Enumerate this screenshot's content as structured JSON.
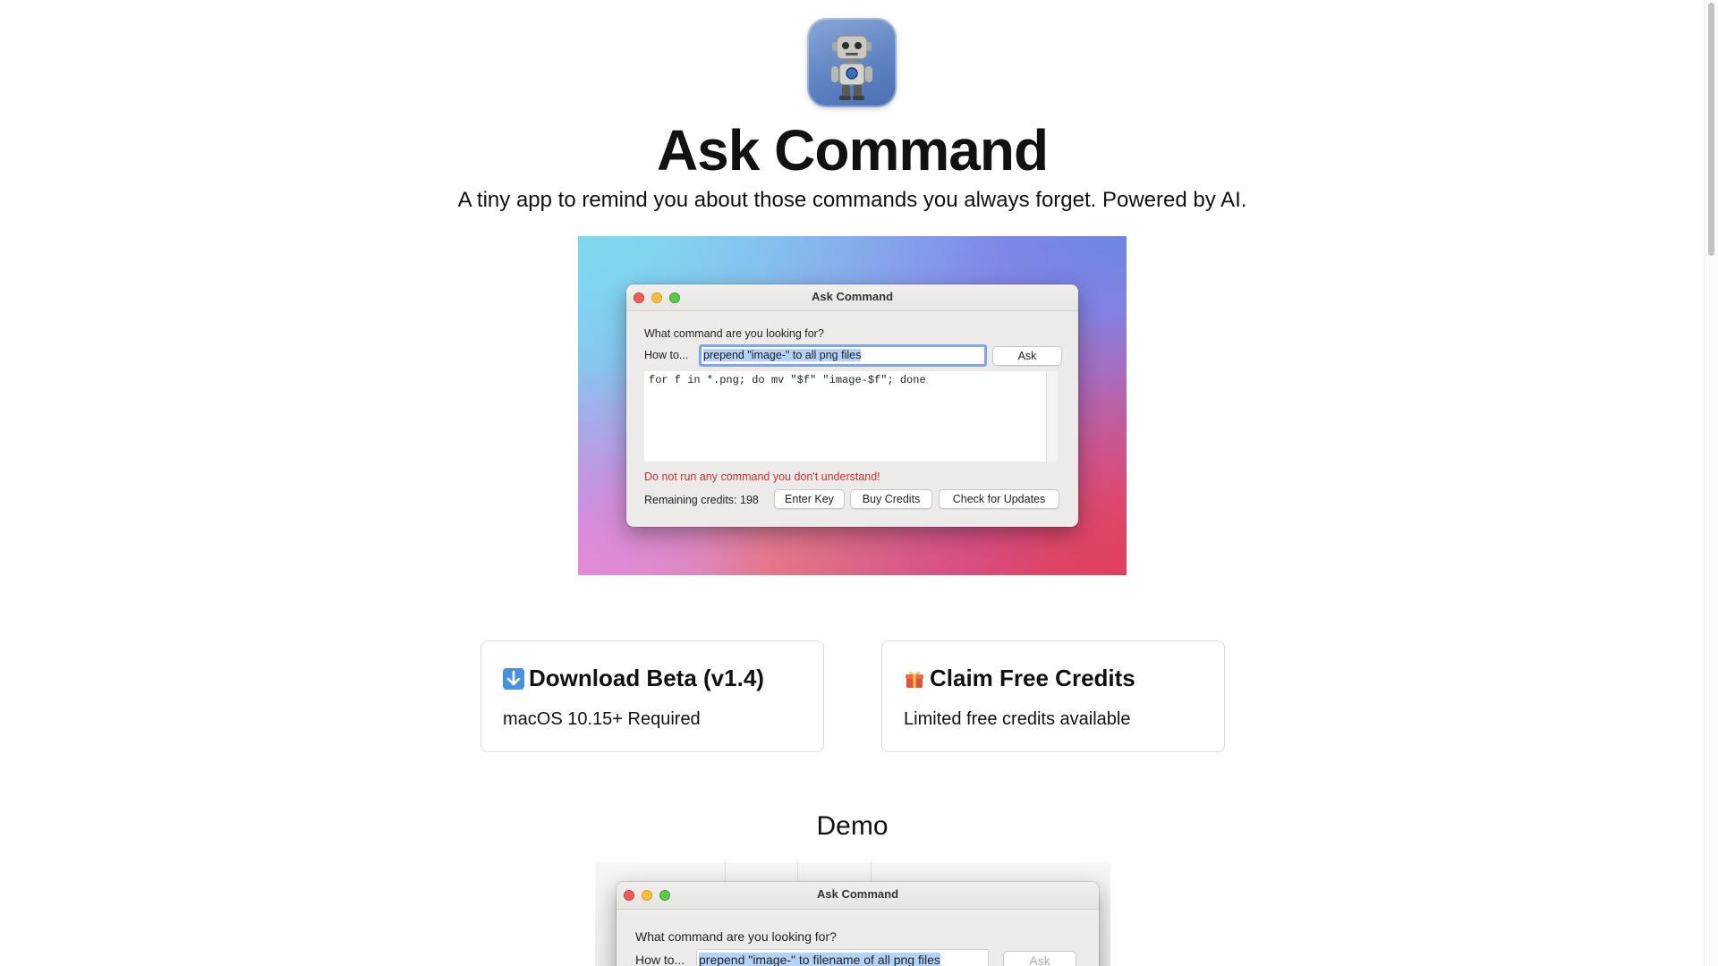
{
  "app": {
    "icon": "robot-app-icon",
    "title": "Ask Command",
    "subtitle": "A tiny app to remind you about those commands you always forget. Powered by AI."
  },
  "hero_window": {
    "title": "Ask Command",
    "prompt_label": "What command are you looking for?",
    "how_to_label": "How to...",
    "input_value": "prepend \"image-\" to all png files",
    "ask_button": "Ask",
    "output": "for f in *.png; do mv \"$f\" \"image-$f\"; done",
    "warning": "Do not run any command you don't understand!",
    "credits_text": "Remaining credits: 198",
    "enter_key_button": "Enter Key",
    "buy_credits_button": "Buy Credits",
    "check_updates_button": "Check for Updates"
  },
  "cards": {
    "download": {
      "icon": "down-arrow-icon",
      "title": "Download Beta (v1.4)",
      "desc": "macOS 10.15+ Required"
    },
    "credits": {
      "icon": "gift-icon",
      "title": "Claim Free Credits",
      "desc": "Limited free credits available"
    }
  },
  "demo": {
    "heading": "Demo",
    "window_title": "Ask Command",
    "prompt_label": "What command are you looking for?",
    "how_to_label": "How to...",
    "input_value": "prepend \"image-\" to filename of all png files",
    "ask_button": "Ask"
  },
  "colors": {
    "warning": "#d0312d",
    "selection": "#b3d2f7",
    "focus_ring": "#7fa6ec",
    "download_icon": "#4a90e2"
  }
}
